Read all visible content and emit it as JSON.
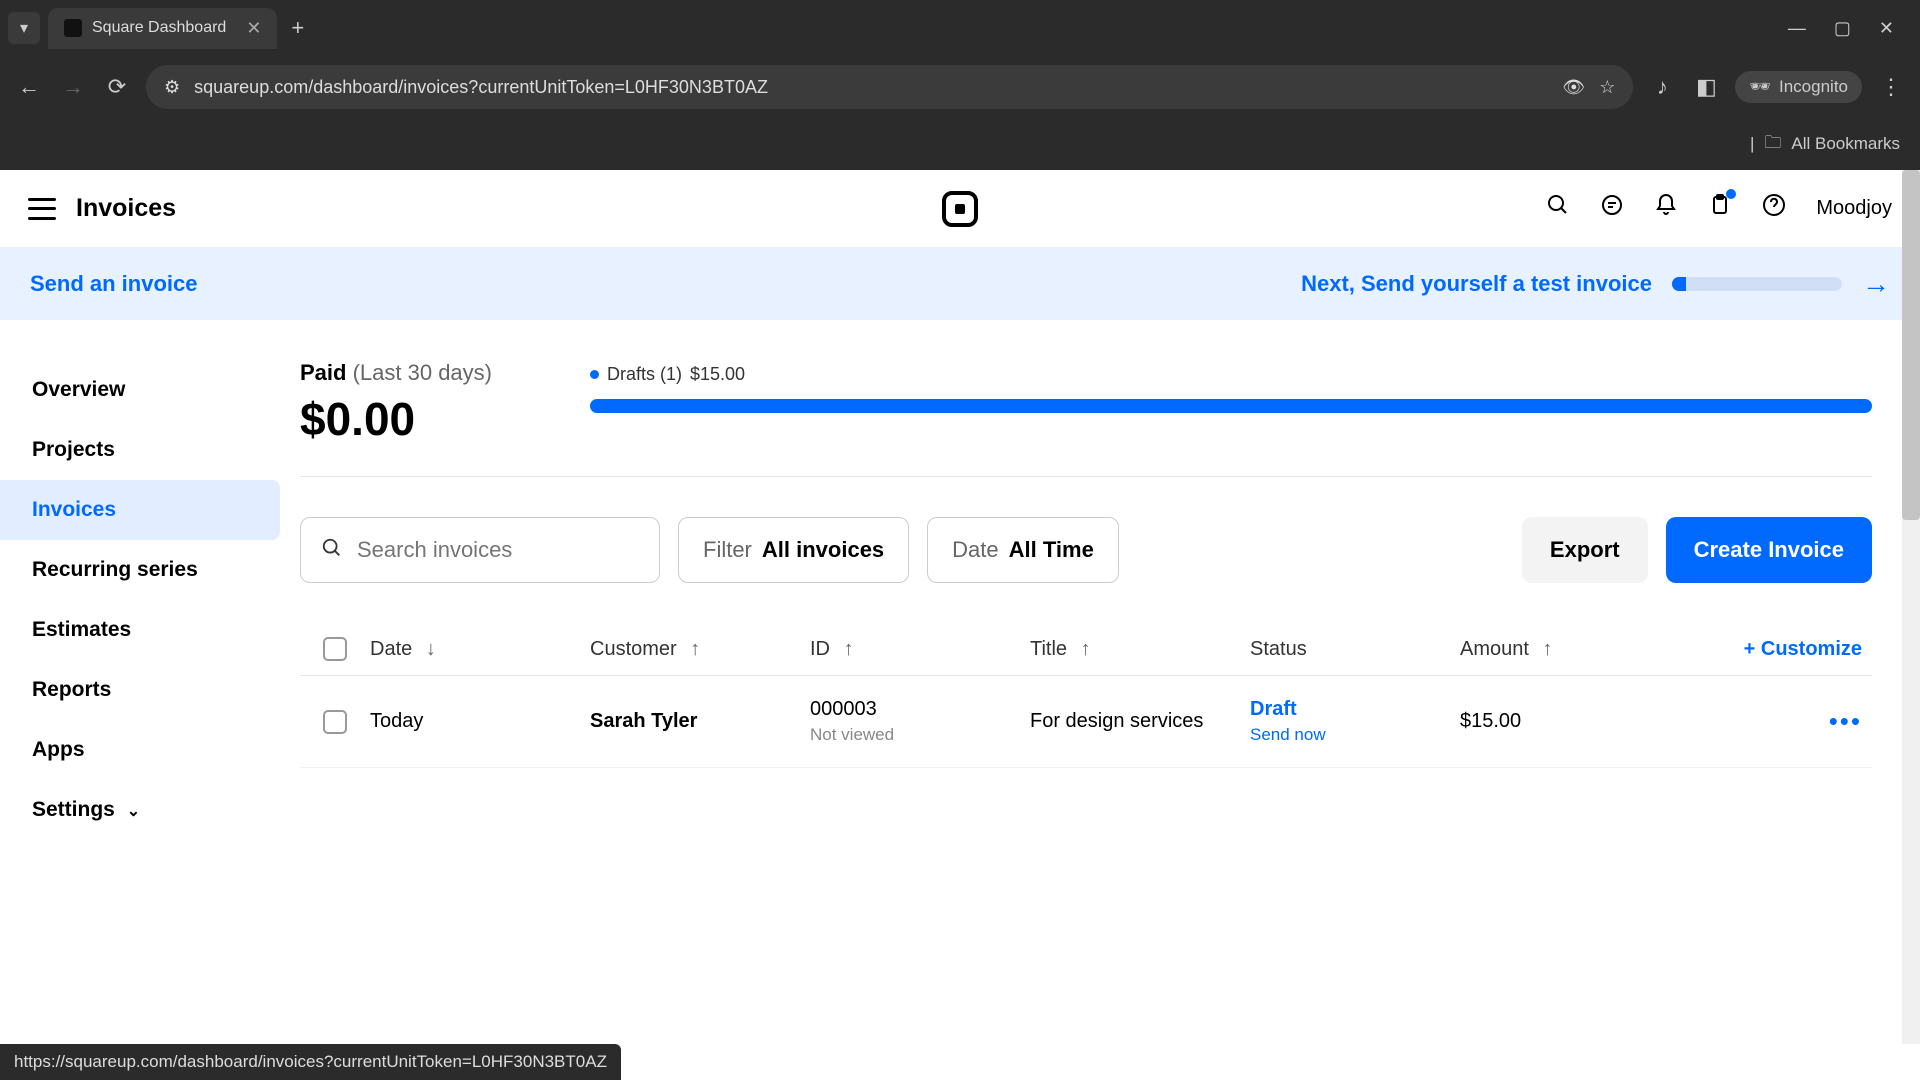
{
  "browser": {
    "tab_title": "Square Dashboard",
    "url": "squareup.com/dashboard/invoices?currentUnitToken=L0HF30N3BT0AZ",
    "incognito_label": "Incognito",
    "bookmarks_label": "All Bookmarks",
    "status_bar": "https://squareup.com/dashboard/invoices?currentUnitToken=L0HF30N3BT0AZ"
  },
  "header": {
    "title": "Invoices",
    "user": "Moodjoy"
  },
  "banner": {
    "left": "Send an invoice",
    "right": "Next, Send yourself a test invoice"
  },
  "sidebar": {
    "items": [
      {
        "label": "Overview",
        "active": false
      },
      {
        "label": "Projects",
        "active": false
      },
      {
        "label": "Invoices",
        "active": true
      },
      {
        "label": "Recurring series",
        "active": false
      },
      {
        "label": "Estimates",
        "active": false
      },
      {
        "label": "Reports",
        "active": false
      },
      {
        "label": "Apps",
        "active": false
      },
      {
        "label": "Settings",
        "active": false,
        "expandable": true
      }
    ]
  },
  "stats": {
    "paid_label": "Paid",
    "paid_range": "(Last 30 days)",
    "paid_amount": "$0.00",
    "drafts_label": "Drafts (1)",
    "drafts_amount": "$15.00"
  },
  "filters": {
    "search_placeholder": "Search invoices",
    "filter_label": "Filter",
    "filter_value": "All invoices",
    "date_label": "Date",
    "date_value": "All Time",
    "export_label": "Export",
    "create_label": "Create Invoice"
  },
  "table": {
    "columns": {
      "date": "Date",
      "customer": "Customer",
      "id": "ID",
      "title": "Title",
      "status": "Status",
      "amount": "Amount",
      "customize": "+ Customize"
    },
    "rows": [
      {
        "date": "Today",
        "customer": "Sarah Tyler",
        "id": "000003",
        "id_sub": "Not viewed",
        "title": "For design services",
        "status": "Draft",
        "status_action": "Send now",
        "amount": "$15.00"
      }
    ]
  }
}
